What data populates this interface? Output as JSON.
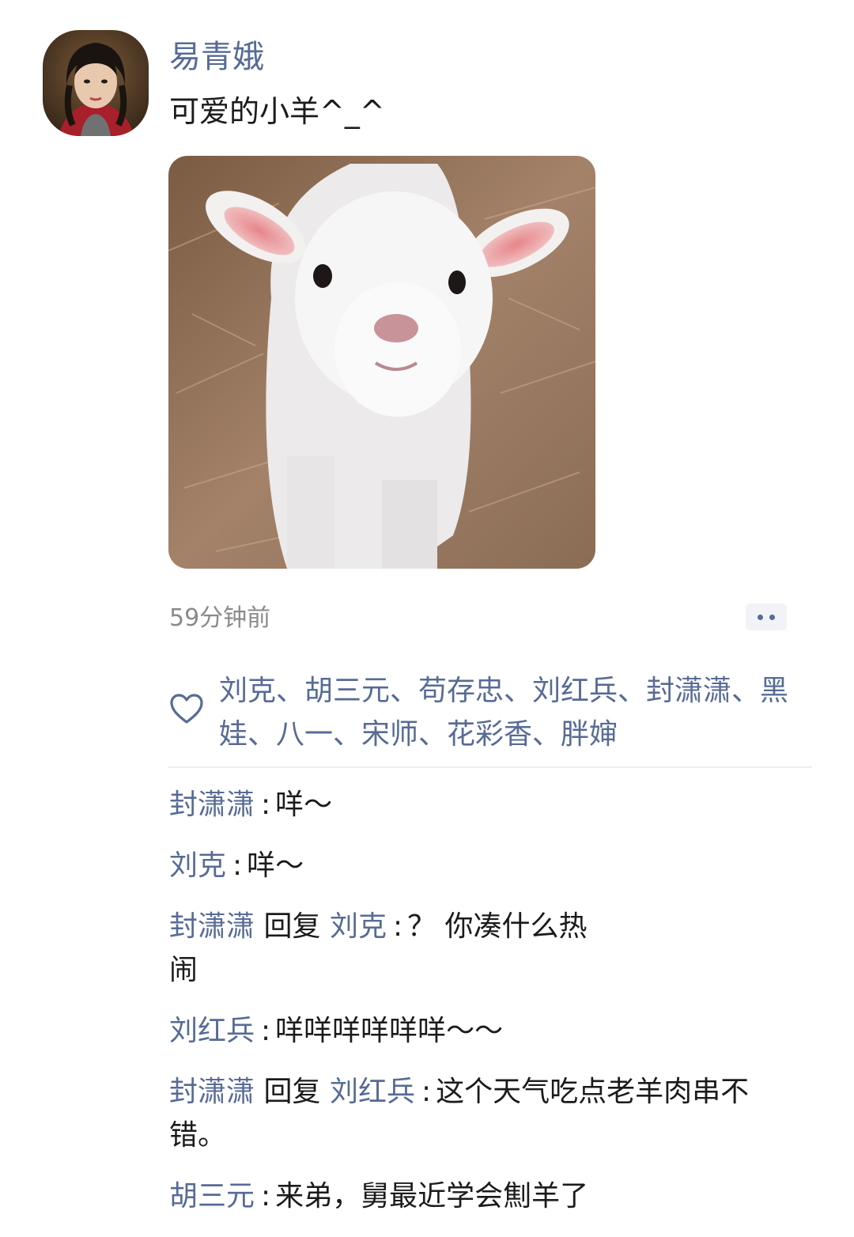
{
  "post": {
    "author": "易青娥",
    "text": "可爱的小羊^_^",
    "time": "59分钟前"
  },
  "likes": {
    "names": "刘克、胡三元、苟存忠、刘红兵、封潇潇、黑娃、八一、宋师、花彩香、胖婶"
  },
  "comments": [
    {
      "from": "封潇潇",
      "text": "咩～"
    },
    {
      "from": "刘克",
      "text": "咩～"
    },
    {
      "from": "封潇潇",
      "reply_word": "回复",
      "to": "刘克",
      "text": "？ 你凑什么热闹"
    },
    {
      "from": "刘红兵",
      "text": "咩咩咩咩咩咩～～"
    },
    {
      "from": "封潇潇",
      "reply_word": "回复",
      "to": "刘红兵",
      "text": "这个天气吃点老羊肉串不错。"
    },
    {
      "from": "胡三元",
      "text": "来弟，舅最近学会劁羊了"
    }
  ],
  "colors": {
    "link": "#576b95",
    "text": "#1b1b1b",
    "muted": "#8a8a8a"
  },
  "icons": {
    "like": "heart-outline-icon",
    "more": "more-dots-icon"
  }
}
